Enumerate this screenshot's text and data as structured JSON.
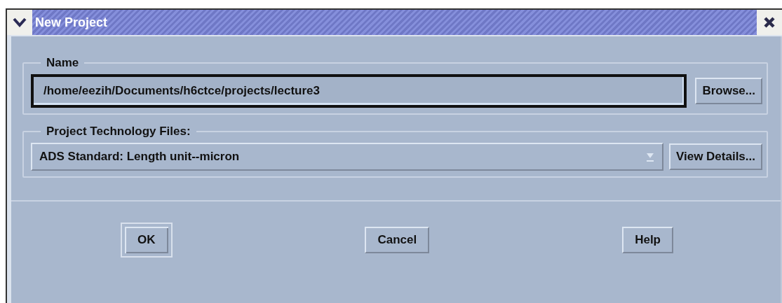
{
  "window": {
    "title": "New Project"
  },
  "name_group": {
    "label": "Name",
    "path_field": {
      "value": "/home/eezih/Documents/h6ctce/projects/lecture3",
      "focused": true
    },
    "browse_button": "Browse..."
  },
  "technology_group": {
    "label": "Project Technology Files:",
    "dropdown": {
      "value": "ADS Standard: Length unit--micron"
    },
    "details_button": "View Details..."
  },
  "buttons": [
    {
      "label": "OK",
      "default": true
    },
    {
      "label": "Cancel",
      "default": false
    },
    {
      "label": "Help",
      "default": false
    }
  ]
}
